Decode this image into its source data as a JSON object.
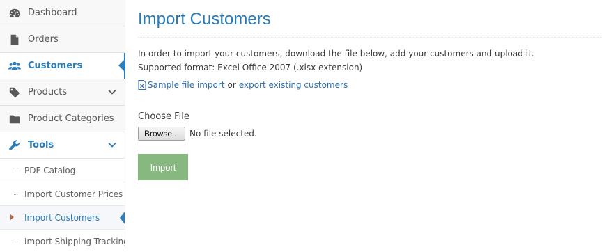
{
  "sidebar": {
    "items": [
      {
        "label": "Dashboard",
        "icon": "dashboard-icon"
      },
      {
        "label": "Orders",
        "icon": "file-icon"
      },
      {
        "label": "Customers",
        "icon": "users-icon"
      },
      {
        "label": "Products",
        "icon": "tag-icon"
      },
      {
        "label": "Product Categories",
        "icon": "folder-icon"
      },
      {
        "label": "Tools",
        "icon": "wrench-icon"
      }
    ],
    "tools_submenu": [
      {
        "label": "PDF Catalog"
      },
      {
        "label": "Import Customer Prices"
      },
      {
        "label": "Import Customers"
      },
      {
        "label": "Import Shipping Tracking"
      }
    ]
  },
  "main": {
    "title": "Import Customers",
    "intro_line1": "In order to import your customers, download the file below, add your customers and upload it.",
    "intro_line2": "Supported format: Excel Office 2007 (.xlsx extension)",
    "sample_link": "Sample file import",
    "or_text": "or",
    "export_link": "export existing customers",
    "file_label": "Choose File",
    "browse_label": "Browse...",
    "file_status": "No file selected.",
    "import_label": "Import"
  },
  "colors": {
    "accent": "#2b7dbc",
    "title": "#2679b5",
    "import_button": "#87b87f",
    "active_caret": "#c86139"
  }
}
